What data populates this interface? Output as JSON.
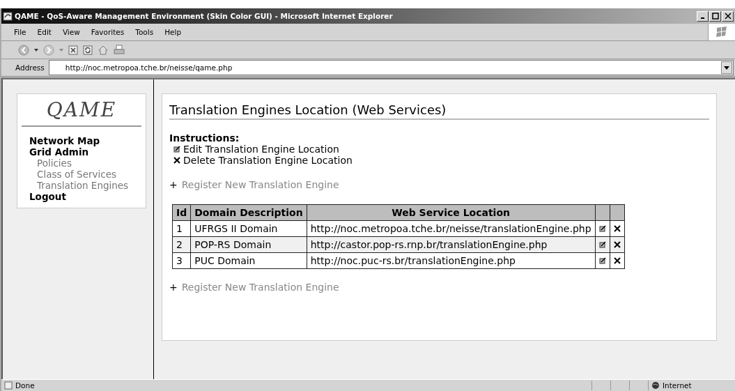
{
  "window": {
    "title": "QAME - QoS-Aware Management Environment (Skin Color GUI) - Microsoft Internet Explorer"
  },
  "menu": [
    "File",
    "Edit",
    "View",
    "Favorites",
    "Tools",
    "Help"
  ],
  "address": {
    "label": "Address",
    "value": "http://noc.metropoa.tche.br/neisse/qame.php"
  },
  "sidebar": {
    "logo": "QAME",
    "items": [
      {
        "label": "Network Map",
        "kind": "section"
      },
      {
        "label": "Grid Admin",
        "kind": "section"
      },
      {
        "label": "Policies",
        "kind": "sub"
      },
      {
        "label": "Class of Services",
        "kind": "sub"
      },
      {
        "label": "Translation Engines",
        "kind": "sub"
      },
      {
        "label": "Logout",
        "kind": "section"
      }
    ]
  },
  "main": {
    "title": "Translation Engines Location (Web Services)",
    "instructions": {
      "heading": "Instructions:",
      "items": [
        {
          "kind": "edit",
          "text": "Edit Translation Engine Location"
        },
        {
          "kind": "delete",
          "text": "Delete Translation Engine Location"
        }
      ]
    },
    "register_top": {
      "icon": "+",
      "label": "Register New Translation Engine"
    },
    "table": {
      "columns": [
        "Id",
        "Domain Description",
        "Web Service Location"
      ],
      "rows": [
        {
          "id": "1",
          "domain": "UFRGS II Domain",
          "url": "http://noc.metropoa.tche.br/neisse/translationEngine.php"
        },
        {
          "id": "2",
          "domain": "POP-RS Domain",
          "url": "http://castor.pop-rs.rnp.br/translationEngine.php"
        },
        {
          "id": "3",
          "domain": "PUC Domain",
          "url": "http://noc.puc-rs.br/translationEngine.php"
        }
      ]
    },
    "register_bottom": {
      "icon": "+",
      "label": "Register New Translation Engine"
    }
  },
  "status_bar": {
    "text": "Done",
    "zone": "Internet"
  }
}
